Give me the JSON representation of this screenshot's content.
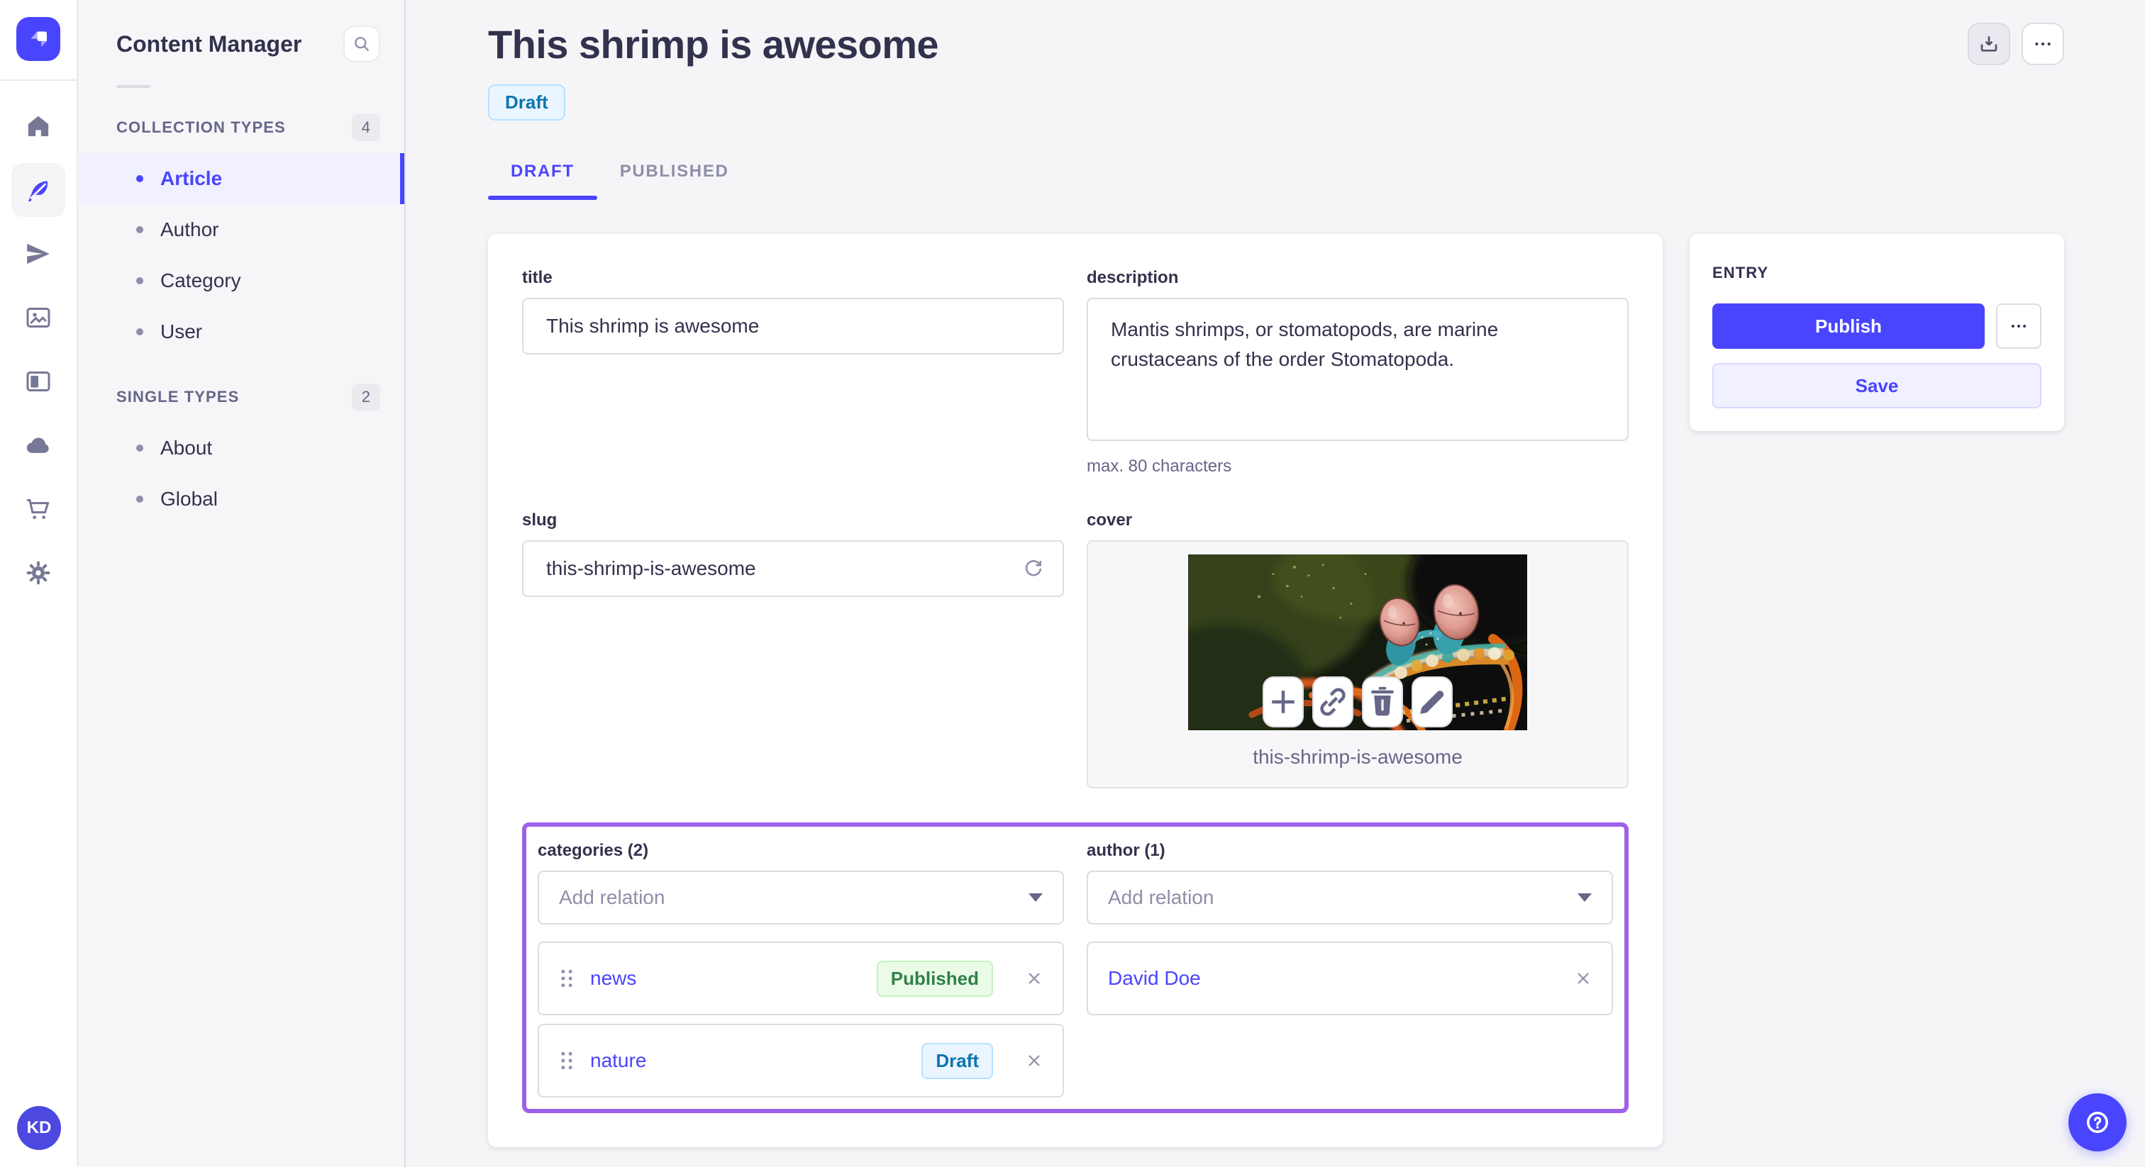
{
  "app": {
    "avatar_initials": "KD",
    "nav_rail_icons": [
      "strapi-logo",
      "home-icon",
      "content-feather-icon",
      "paper-plane-icon",
      "media-library-icon",
      "layout-icon",
      "cloud-icon",
      "cart-icon",
      "gear-icon"
    ],
    "colors": {
      "accent": "#4945FF",
      "accent_light_bg": "#F0F0FF",
      "relation_highlight": "#9D60EA",
      "published_badge_text": "#328048",
      "published_badge_bg": "#EAFBE7",
      "draft_badge_text": "#0C75AF",
      "draft_badge_bg": "#EAF5FF",
      "page_bg": "#F5F5F8",
      "text_dark": "#32324D",
      "text_muted": "#666687"
    }
  },
  "sidebar": {
    "title": "Content Manager",
    "sections": [
      {
        "label": "COLLECTION TYPES",
        "count": "4",
        "items": [
          {
            "label": "Article"
          },
          {
            "label": "Author"
          },
          {
            "label": "Category"
          },
          {
            "label": "User"
          }
        ]
      },
      {
        "label": "SINGLE TYPES",
        "count": "2",
        "items": [
          {
            "label": "About"
          },
          {
            "label": "Global"
          }
        ]
      }
    ]
  },
  "header": {
    "title": "This shrimp is awesome",
    "status": "Draft",
    "tabs": [
      {
        "label": "DRAFT"
      },
      {
        "label": "PUBLISHED"
      }
    ]
  },
  "form": {
    "title_field": {
      "label": "title",
      "value": "This shrimp is awesome"
    },
    "description_field": {
      "label": "description",
      "value": "Mantis shrimps, or stomatopods, are marine crustaceans of the order Stomatopoda.",
      "hint": "max. 80 characters"
    },
    "slug_field": {
      "label": "slug",
      "value": "this-shrimp-is-awesome"
    },
    "cover_field": {
      "label": "cover",
      "caption": "this-shrimp-is-awesome"
    },
    "categories": {
      "label": "categories (2)",
      "placeholder": "Add relation",
      "items": [
        {
          "name": "news",
          "badge": "Published"
        },
        {
          "name": "nature",
          "badge": "Draft"
        }
      ]
    },
    "author": {
      "label": "author (1)",
      "placeholder": "Add relation",
      "items": [
        {
          "name": "David Doe"
        }
      ]
    }
  },
  "entry": {
    "title": "ENTRY",
    "publish_label": "Publish",
    "save_label": "Save"
  }
}
